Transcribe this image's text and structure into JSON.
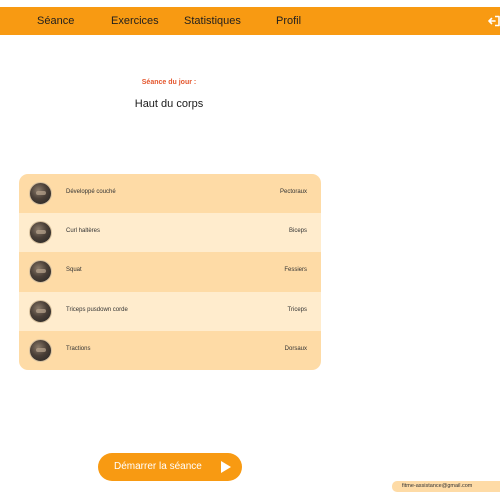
{
  "nav": {
    "items": [
      {
        "label": "Séance"
      },
      {
        "label": "Exercices"
      },
      {
        "label": "Statistiques"
      },
      {
        "label": "Profil"
      }
    ],
    "logout_icon": "logout-arrow-icon"
  },
  "session": {
    "day_label": "Séance du jour :",
    "title": "Haut du corps"
  },
  "exercises": [
    {
      "name": "Développé couché",
      "muscle": "Pectoraux"
    },
    {
      "name": "Curl haltères",
      "muscle": "Biceps"
    },
    {
      "name": "Squat",
      "muscle": "Fessiers"
    },
    {
      "name": "Triceps pusdown corde",
      "muscle": "Triceps"
    },
    {
      "name": "Tractions",
      "muscle": "Dorsaux"
    }
  ],
  "start_button": {
    "label": "Démarrer la séance",
    "icon": "play-icon"
  },
  "contact": {
    "email": "fitme-assistance@gmail.com"
  },
  "colors": {
    "accent": "#f89a12",
    "label_red": "#e4572e",
    "row_dark": "#fedba6",
    "row_light": "#ffeccd"
  }
}
